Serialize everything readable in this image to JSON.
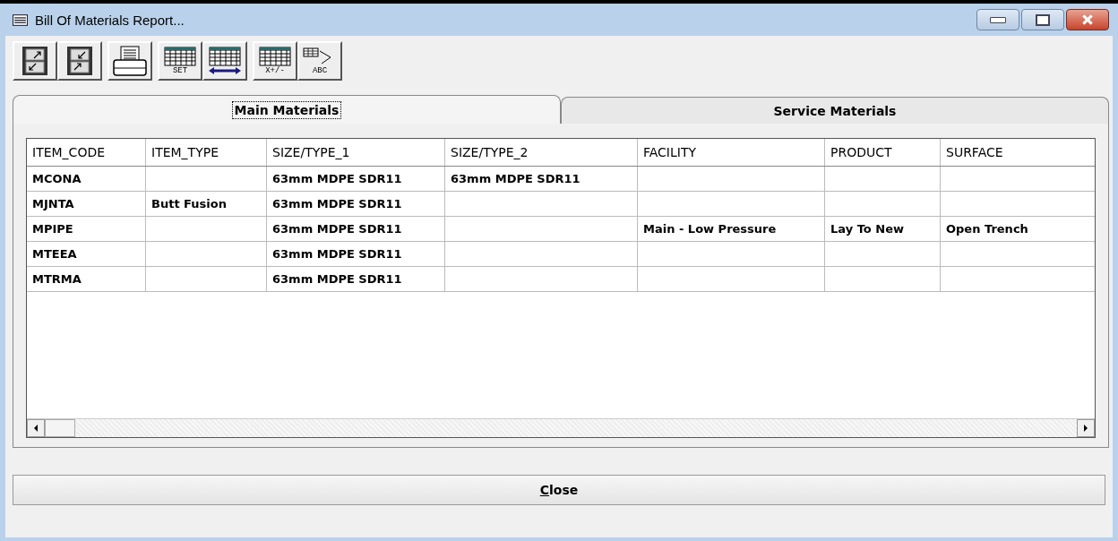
{
  "window": {
    "title": "Bill Of Materials Report..."
  },
  "toolbar": [
    [
      {
        "kind": "enlarge"
      },
      {
        "kind": "shrink"
      }
    ],
    [
      {
        "kind": "print"
      }
    ],
    [
      {
        "kind": "grid",
        "label": "SET"
      },
      {
        "kind": "grid-arrow"
      }
    ],
    [
      {
        "kind": "grid",
        "label": "X+/-"
      },
      {
        "kind": "abc",
        "label": "ABC"
      }
    ]
  ],
  "tabs": [
    {
      "label": "Main Materials",
      "selected": true
    },
    {
      "label": "Service Materials",
      "selected": false
    }
  ],
  "table": {
    "columns": [
      "ITEM_CODE",
      "ITEM_TYPE",
      "SIZE/TYPE_1",
      "SIZE/TYPE_2",
      "FACILITY",
      "PRODUCT",
      "SURFACE"
    ],
    "rows": [
      [
        "MCONA",
        "",
        "63mm MDPE SDR11",
        "63mm MDPE SDR11",
        "",
        "",
        ""
      ],
      [
        "MJNTA",
        "Butt Fusion",
        "63mm MDPE SDR11",
        "",
        "",
        "",
        ""
      ],
      [
        "MPIPE",
        "",
        "63mm MDPE SDR11",
        "",
        "Main - Low Pressure",
        "Lay To New",
        "Open Trench"
      ],
      [
        "MTEEA",
        "",
        "63mm MDPE SDR11",
        "",
        "",
        "",
        ""
      ],
      [
        "MTRMA",
        "",
        "63mm MDPE SDR11",
        "",
        "",
        "",
        ""
      ]
    ]
  },
  "close_button": "Close"
}
